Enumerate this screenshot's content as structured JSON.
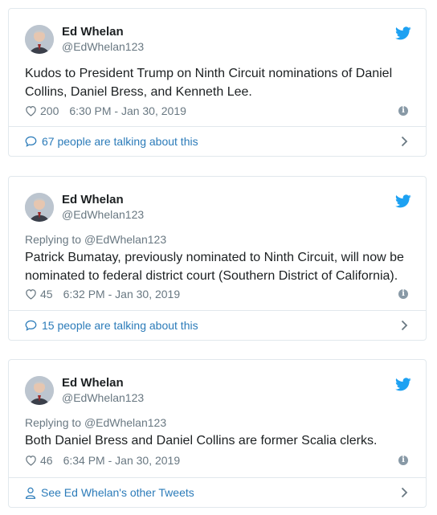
{
  "tweets": [
    {
      "author_name": "Ed Whelan",
      "author_handle": "@EdWhelan123",
      "reply_prefix": "",
      "reply_to": "",
      "text": "Kudos to President Trump on Ninth Circuit nominations of Daniel Collins, Daniel Bress, and Kenneth Lee.",
      "likes": "200",
      "timestamp": "6:30 PM - Jan 30, 2019",
      "footer_link": "67 people are talking about this",
      "footer_icon": "speech-bubble-icon"
    },
    {
      "author_name": "Ed Whelan",
      "author_handle": "@EdWhelan123",
      "reply_prefix": "Replying to",
      "reply_to": "@EdWhelan123",
      "text": "Patrick Bumatay, previously nominated to Ninth Circuit, will now be nominated to federal district court (Southern District of California).",
      "likes": "45",
      "timestamp": "6:32 PM - Jan 30, 2019",
      "footer_link": "15 people are talking about this",
      "footer_icon": "speech-bubble-icon"
    },
    {
      "author_name": "Ed Whelan",
      "author_handle": "@EdWhelan123",
      "reply_prefix": "Replying to",
      "reply_to": "@EdWhelan123",
      "text": "Both Daniel Bress and Daniel Collins are former Scalia clerks.",
      "likes": "46",
      "timestamp": "6:34 PM - Jan 30, 2019",
      "footer_link": "See Ed Whelan's other Tweets",
      "footer_icon": "person-icon"
    }
  ],
  "colors": {
    "twitter_blue": "#1da1f2",
    "link_blue": "#2b7bb9",
    "muted": "#697882",
    "border": "#e1e8ed"
  }
}
